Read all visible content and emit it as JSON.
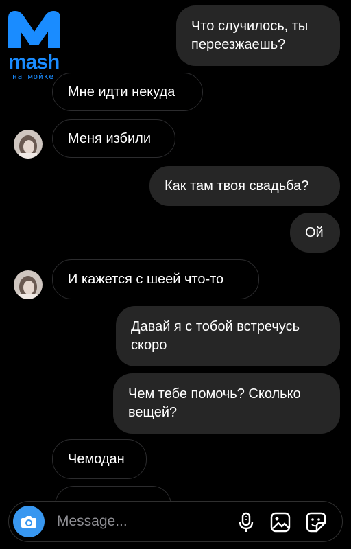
{
  "watermark": {
    "brand": "mash",
    "subtitle": "на мойке"
  },
  "colors": {
    "brand": "#1a8cff",
    "camera": "#3897f0",
    "bubble_out": "#262626",
    "bubble_in_border": "#2c2c2e",
    "placeholder": "#8e8e93"
  },
  "messages": [
    {
      "side": "out",
      "text": "Что случилось, ты переезжаешь?"
    },
    {
      "side": "in",
      "text": "Мне идти некуда"
    },
    {
      "side": "in",
      "text": "Меня избили"
    },
    {
      "side": "out",
      "text": "Как там твоя свадьба?"
    },
    {
      "side": "out",
      "text": "Ой"
    },
    {
      "side": "in",
      "text": "И кажется с шеей что-то"
    },
    {
      "side": "out",
      "text": "Давай я с тобой встречусь скоро"
    },
    {
      "side": "out",
      "text": "Чем тебе помочь? Сколько вещей?"
    },
    {
      "side": "in",
      "text": "Чемодан"
    }
  ],
  "composer": {
    "placeholder": "Message...",
    "icons": [
      "camera-icon",
      "microphone-icon",
      "gallery-icon",
      "sticker-icon"
    ]
  }
}
